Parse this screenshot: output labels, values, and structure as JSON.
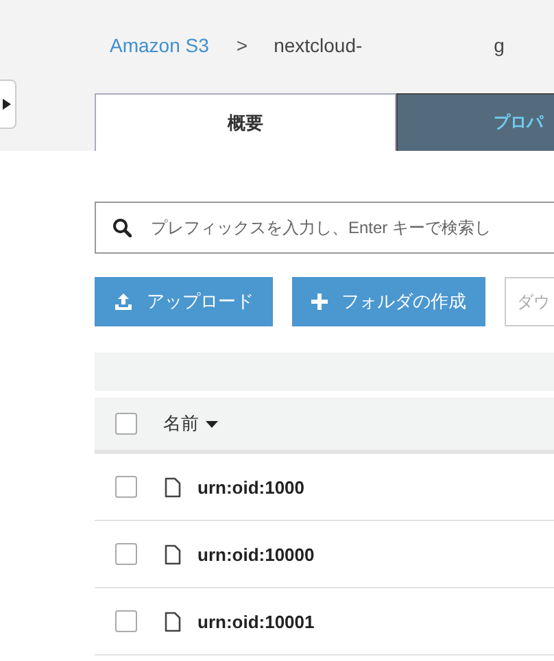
{
  "breadcrumb": {
    "root": "Amazon S3",
    "separator": ">",
    "path": [
      "nextcloud-",
      "g"
    ]
  },
  "sidebar_toggle": {
    "expanded": false
  },
  "tabs": [
    {
      "label": "概要",
      "selected": true
    },
    {
      "label": "プロパ",
      "selected": false
    }
  ],
  "search": {
    "placeholder": "プレフィックスを入力し、Enter キーで検索し"
  },
  "buttons": [
    {
      "label": "アップロード",
      "kind": "upload",
      "disabled": false
    },
    {
      "label": "フォルダの作成",
      "kind": "folder",
      "disabled": false
    },
    {
      "label": "ダウ",
      "kind": "plain",
      "disabled": true
    }
  ],
  "table": {
    "columns": [
      {
        "label": "名前",
        "sort_descending": true
      }
    ],
    "all_checked": false,
    "rows": [
      {
        "name": "urn:oid:1000",
        "checked": false
      },
      {
        "name": "urn:oid:10000",
        "checked": false
      },
      {
        "name": "urn:oid:10001",
        "checked": false
      }
    ]
  }
}
